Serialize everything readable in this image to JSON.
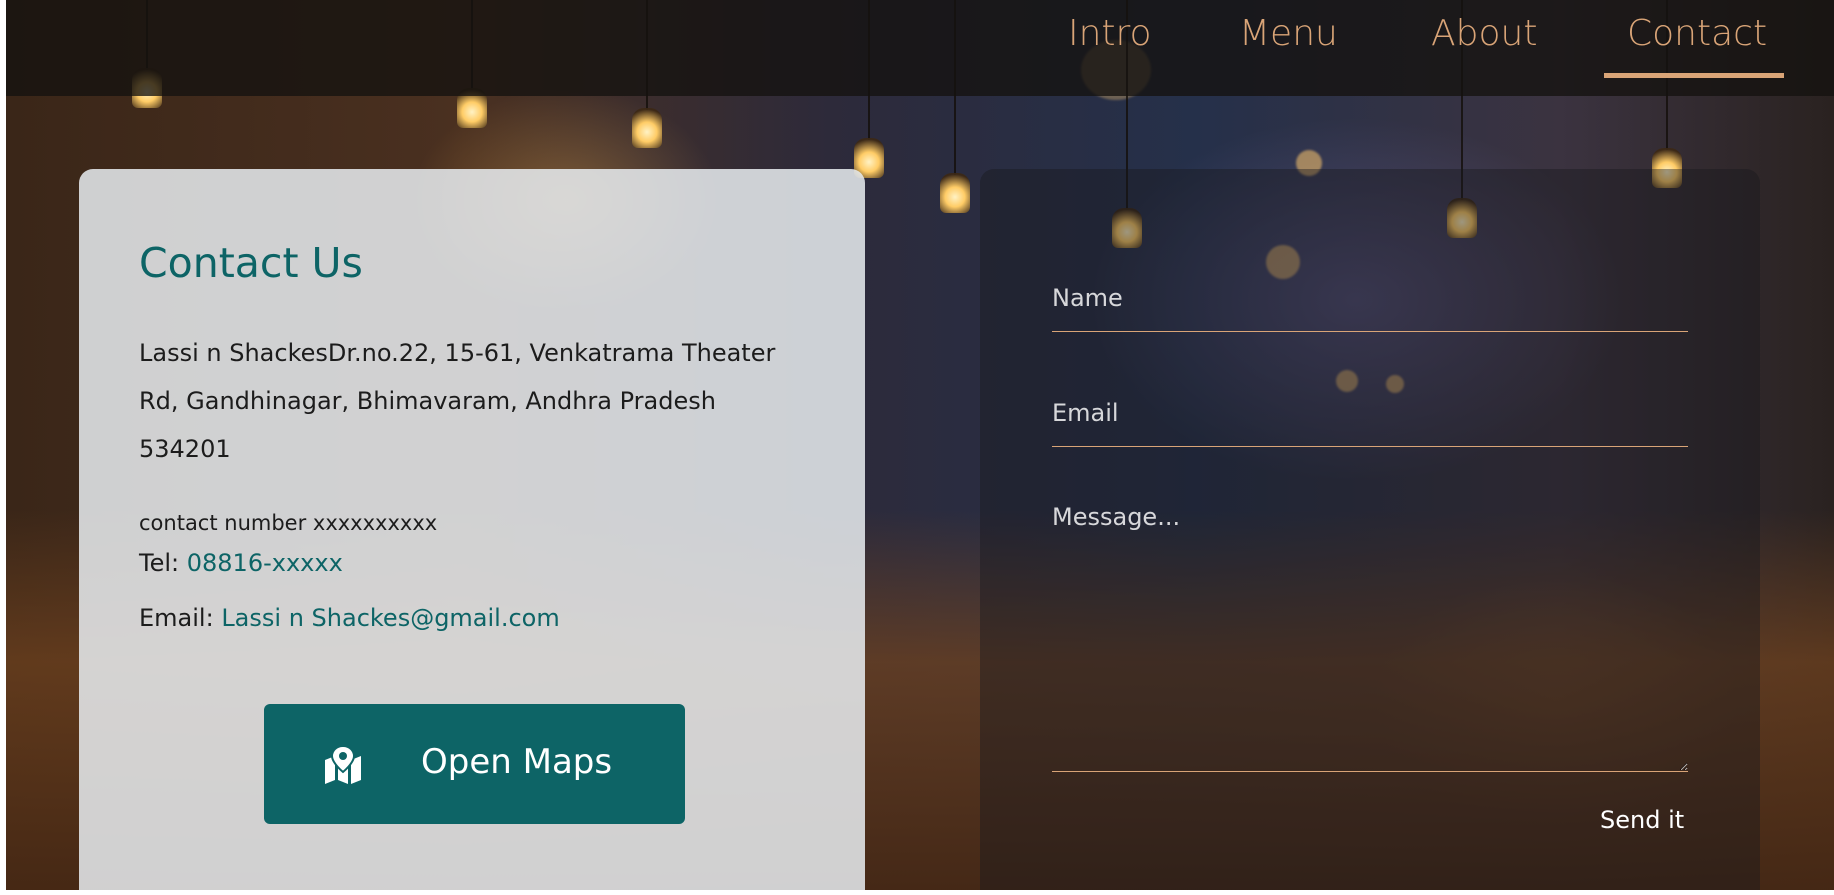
{
  "nav": {
    "items": [
      {
        "label": "Intro"
      },
      {
        "label": "Menu"
      },
      {
        "label": "About"
      },
      {
        "label": "Contact"
      }
    ],
    "active": "Contact"
  },
  "contact": {
    "title": "Contact Us",
    "address": "Lassi n ShackesDr.no.22, 15-61, Venkatrama Theater Rd, Gandhinagar, Bhimavaram, Andhra Pradesh 534201",
    "contact_number_label": "contact number xxxxxxxxxx",
    "tel_label": "Tel:",
    "tel_value": "08816-xxxxx",
    "email_label": "Email:",
    "email_value": "Lassi n Shackes@gmail.com",
    "maps_button": {
      "label": "Open Maps",
      "icon": "map-marker-icon"
    }
  },
  "form": {
    "name_placeholder": "Name",
    "email_placeholder": "Email",
    "message_placeholder": "Message...",
    "send_label": "Send it"
  },
  "colors": {
    "accent": "#d9a477",
    "brand": "#0d6466",
    "info_card_bg": "#e8ecf0"
  }
}
